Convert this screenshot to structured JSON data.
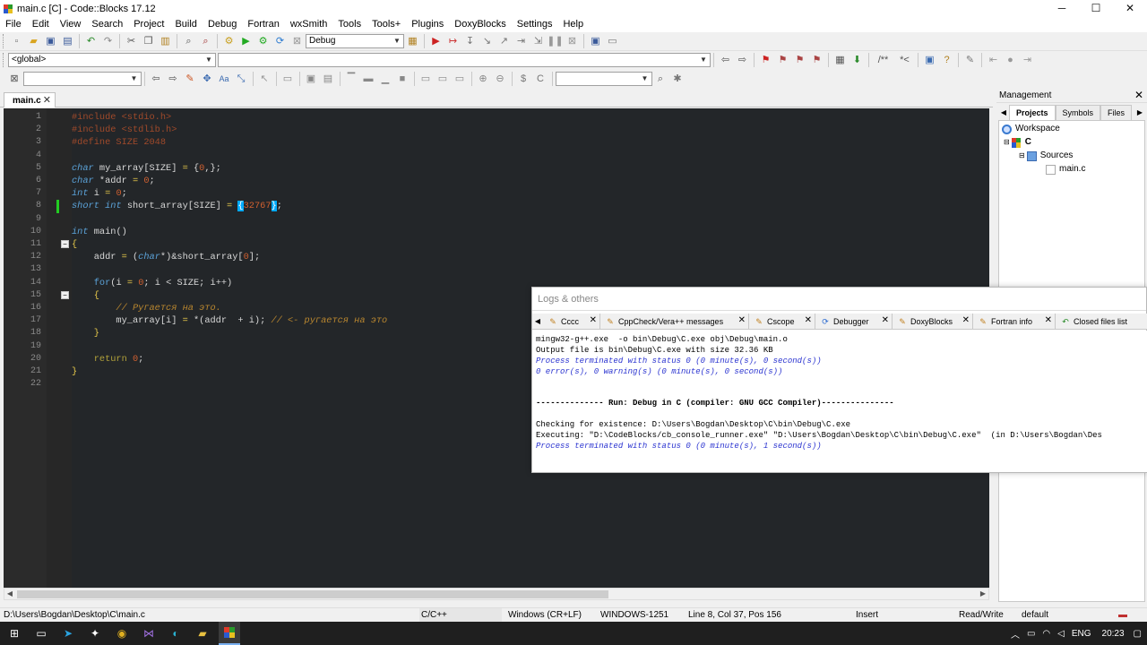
{
  "window": {
    "title": "main.c [C] - Code::Blocks 17.12",
    "controls": {
      "minimize": "─",
      "maximize": "☐",
      "close": "✕"
    }
  },
  "menubar": {
    "items": [
      "File",
      "Edit",
      "View",
      "Search",
      "Project",
      "Build",
      "Debug",
      "Fortran",
      "wxSmith",
      "Tools",
      "Tools+",
      "Plugins",
      "DoxyBlocks",
      "Settings",
      "Help"
    ]
  },
  "toolbar": {
    "build_target": "Debug",
    "scope_combo": "<global>",
    "code_combo": "",
    "search_combo": ""
  },
  "editor": {
    "tab_label": "main.c",
    "lines": [
      {
        "n": "1",
        "tokens": [
          [
            "pre",
            "#include <stdio.h>"
          ]
        ]
      },
      {
        "n": "2",
        "tokens": [
          [
            "pre",
            "#include <stdlib.h>"
          ]
        ]
      },
      {
        "n": "3",
        "tokens": [
          [
            "pre",
            "#define SIZE 2048"
          ]
        ]
      },
      {
        "n": "4",
        "tokens": []
      },
      {
        "n": "5",
        "tokens": [
          [
            "kw",
            "char"
          ],
          [
            "id",
            " my_array[SIZE] "
          ],
          [
            "op",
            "="
          ],
          [
            "id",
            " {"
          ],
          [
            "num",
            "0"
          ],
          [
            "id",
            ",};"
          ]
        ]
      },
      {
        "n": "6",
        "tokens": [
          [
            "kw",
            "char"
          ],
          [
            "id",
            " *addr "
          ],
          [
            "op",
            "="
          ],
          [
            "id",
            " "
          ],
          [
            "num",
            "0"
          ],
          [
            "id",
            ";"
          ]
        ]
      },
      {
        "n": "7",
        "tokens": [
          [
            "kw",
            "int"
          ],
          [
            "id",
            " i "
          ],
          [
            "op",
            "="
          ],
          [
            "id",
            " "
          ],
          [
            "num",
            "0"
          ],
          [
            "id",
            ";"
          ]
        ]
      },
      {
        "n": "8",
        "tokens": [
          [
            "kw",
            "short"
          ],
          [
            "id",
            " "
          ],
          [
            "kw",
            "int"
          ],
          [
            "id",
            " short_array[SIZE] "
          ],
          [
            "op",
            "="
          ],
          [
            "id",
            " "
          ],
          [
            "brace",
            "{"
          ],
          [
            "num",
            "32767"
          ],
          [
            "brace",
            "}"
          ],
          [
            "id",
            ";"
          ]
        ]
      },
      {
        "n": "9",
        "tokens": []
      },
      {
        "n": "10",
        "tokens": [
          [
            "kw",
            "int"
          ],
          [
            "id",
            " main()"
          ]
        ]
      },
      {
        "n": "11",
        "tokens": [
          [
            "op",
            "{"
          ]
        ]
      },
      {
        "n": "12",
        "tokens": [
          [
            "id",
            "    addr "
          ],
          [
            "op",
            "="
          ],
          [
            "id",
            " ("
          ],
          [
            "kw",
            "char"
          ],
          [
            "id",
            "*)&short_array["
          ],
          [
            "num",
            "0"
          ],
          [
            "id",
            "];"
          ]
        ]
      },
      {
        "n": "13",
        "tokens": []
      },
      {
        "n": "14",
        "tokens": [
          [
            "id",
            "    "
          ],
          [
            "kw2",
            "for"
          ],
          [
            "id",
            "(i "
          ],
          [
            "op",
            "="
          ],
          [
            "id",
            " "
          ],
          [
            "num",
            "0"
          ],
          [
            "id",
            "; i < SIZE; i++)"
          ]
        ]
      },
      {
        "n": "15",
        "tokens": [
          [
            "op",
            "    {"
          ]
        ]
      },
      {
        "n": "16",
        "tokens": [
          [
            "cmt",
            "        // Ругается на это."
          ]
        ]
      },
      {
        "n": "17",
        "tokens": [
          [
            "id",
            "        my_array[i] "
          ],
          [
            "op",
            "="
          ],
          [
            "id",
            " *(addr  + i); "
          ],
          [
            "cmt",
            "// <- ругается на это"
          ]
        ]
      },
      {
        "n": "18",
        "tokens": [
          [
            "op",
            "    }"
          ]
        ]
      },
      {
        "n": "19",
        "tokens": []
      },
      {
        "n": "20",
        "tokens": [
          [
            "id",
            "    "
          ],
          [
            "ret",
            "return"
          ],
          [
            "id",
            " "
          ],
          [
            "num",
            "0"
          ],
          [
            "id",
            ";"
          ]
        ]
      },
      {
        "n": "21",
        "tokens": [
          [
            "op",
            "}"
          ]
        ]
      },
      {
        "n": "22",
        "tokens": []
      }
    ]
  },
  "management": {
    "title": "Management",
    "tabs": [
      "Projects",
      "Symbols",
      "Files"
    ],
    "active_tab": "Projects",
    "tree": {
      "workspace": "Workspace",
      "project": "C",
      "folder": "Sources",
      "file": "main.c"
    }
  },
  "logs": {
    "title": "Logs & others",
    "tabs": [
      "Cccc",
      "CppCheck/Vera++ messages",
      "Cscope",
      "Debugger",
      "DoxyBlocks",
      "Fortran info",
      "Closed files list"
    ],
    "lines": [
      {
        "style": "normal",
        "text": "mingw32-g++.exe  -o bin\\Debug\\C.exe obj\\Debug\\main.o"
      },
      {
        "style": "normal",
        "text": "Output file is bin\\Debug\\C.exe with size 32.36 KB"
      },
      {
        "style": "blue",
        "text": "Process terminated with status 0 (0 minute(s), 0 second(s))"
      },
      {
        "style": "blue",
        "text": "0 error(s), 0 warning(s) (0 minute(s), 0 second(s))"
      },
      {
        "style": "normal",
        "text": ""
      },
      {
        "style": "normal",
        "text": ""
      },
      {
        "style": "bold",
        "text": "-------------- Run: Debug in C (compiler: GNU GCC Compiler)---------------"
      },
      {
        "style": "normal",
        "text": ""
      },
      {
        "style": "normal",
        "text": "Checking for existence: D:\\Users\\Bogdan\\Desktop\\C\\bin\\Debug\\C.exe"
      },
      {
        "style": "normal",
        "text": "Executing: \"D:\\CodeBlocks/cb_console_runner.exe\" \"D:\\Users\\Bogdan\\Desktop\\C\\bin\\Debug\\C.exe\"  (in D:\\Users\\Bogdan\\Des"
      },
      {
        "style": "blue",
        "text": "Process terminated with status 0 (0 minute(s), 1 second(s))"
      }
    ]
  },
  "statusbar": {
    "path": "D:\\Users\\Bogdan\\Desktop\\C\\main.c",
    "language": "C/C++",
    "eol": "Windows (CR+LF)",
    "encoding": "WINDOWS-1251",
    "position": "Line 8, Col 37, Pos 156",
    "mode": "Insert",
    "access": "Read/Write",
    "profile": "default"
  },
  "taskbar": {
    "lang": "ENG",
    "time": "20:23"
  },
  "colors": {
    "editor_bg": "#232629",
    "gutter_bg": "#2b2b2b",
    "keyword": "#5ba2d8",
    "preprocessor": "#a04a2a",
    "number": "#d06030",
    "comment": "#b8862f",
    "brace_match": "#00aaff",
    "log_blue": "#2a33d0"
  }
}
